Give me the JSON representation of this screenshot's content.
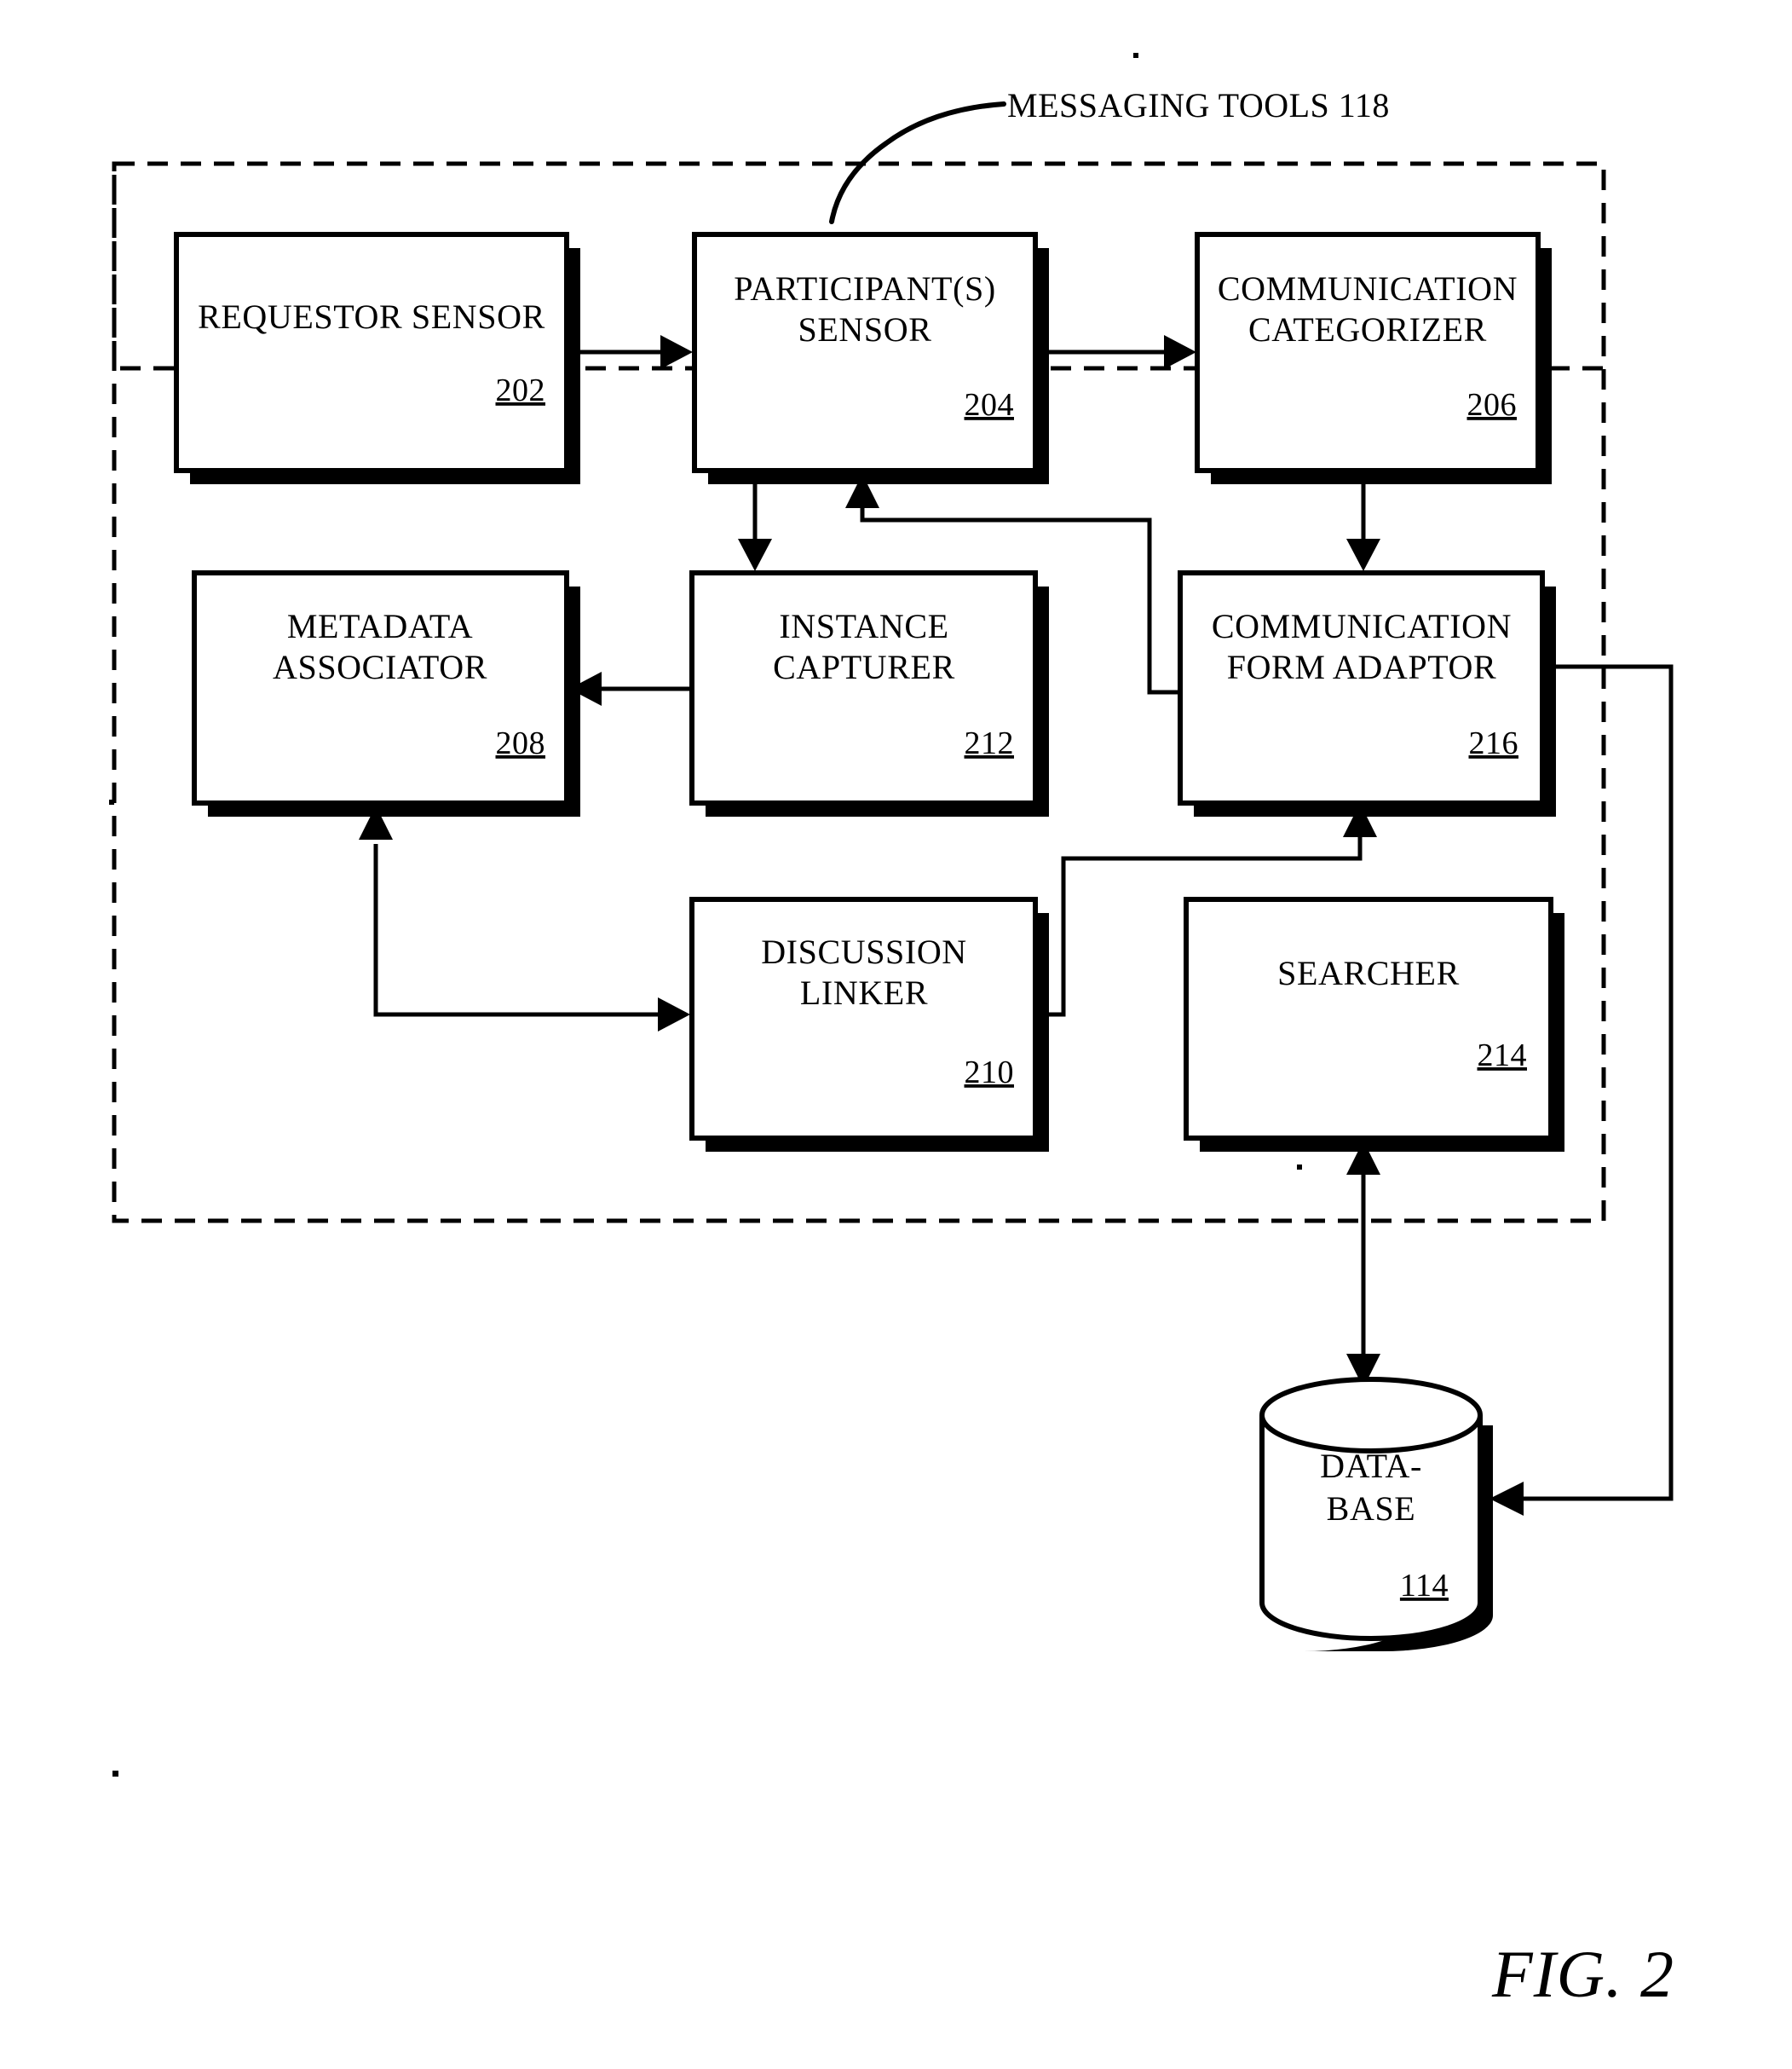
{
  "figure": {
    "caption": "FIG. 2",
    "boundary_label": "MESSAGING TOOLS 118"
  },
  "blocks": [
    {
      "id": "requestor-sensor",
      "line1": "REQUESTOR SENSOR",
      "line2": "",
      "ref": "202"
    },
    {
      "id": "participants-sensor",
      "line1": "PARTICIPANT(S)",
      "line2": "SENSOR",
      "ref": "204"
    },
    {
      "id": "communication-categorizer",
      "line1": "COMMUNICATION",
      "line2": "CATEGORIZER",
      "ref": "206"
    },
    {
      "id": "metadata-associator",
      "line1": "METADATA",
      "line2": "ASSOCIATOR",
      "ref": "208"
    },
    {
      "id": "instance-capturer",
      "line1": "INSTANCE",
      "line2": "CAPTURER",
      "ref": "212"
    },
    {
      "id": "communication-form-adaptor",
      "line1": "COMMUNICATION",
      "line2": "FORM ADAPTOR",
      "ref": "216"
    },
    {
      "id": "discussion-linker",
      "line1": "DISCUSSION",
      "line2": "LINKER",
      "ref": "210"
    },
    {
      "id": "searcher",
      "line1": "SEARCHER",
      "line2": "",
      "ref": "214"
    }
  ],
  "datastore": {
    "id": "database",
    "line1": "DATA-",
    "line2": "BASE",
    "ref": "114"
  },
  "colors": {
    "ink": "#000000",
    "paper": "#ffffff"
  }
}
